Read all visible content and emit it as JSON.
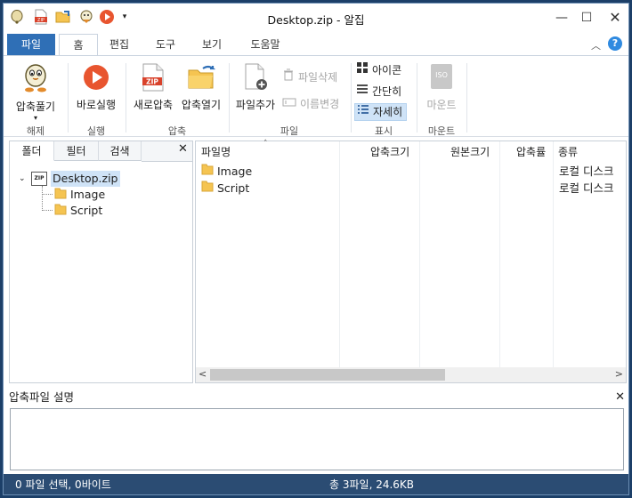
{
  "window": {
    "title": "Desktop.zip - 알집",
    "controls": [
      "minimize",
      "maximize",
      "close"
    ]
  },
  "quick_access": [
    "alzip-logo-icon",
    "zip-file-icon",
    "folder-open-icon",
    "unzip-icon",
    "run-icon",
    "dropdown-arrow"
  ],
  "ribbon_tabs": [
    "파일",
    "홈",
    "편집",
    "도구",
    "보기",
    "도움말"
  ],
  "active_tab": "홈",
  "ribbon": {
    "extract": {
      "label": "압축풀기",
      "group": "해제"
    },
    "run": {
      "label": "바로실행",
      "group": "실행"
    },
    "new_zip": {
      "label": "새로압축"
    },
    "open_zip": {
      "label": "압축열기"
    },
    "compress_group": "압축",
    "add_file": {
      "label": "파일추가"
    },
    "delete_file": {
      "label": "파일삭제"
    },
    "rename": {
      "label": "이름변경"
    },
    "file_group": "파일",
    "view_icon": "아이콘",
    "view_simple": "간단히",
    "view_detail": "자세히",
    "view_group": "표시",
    "mount": {
      "label": "마운트",
      "icon_text": "ISO",
      "group": "마운트"
    }
  },
  "tree_panel": {
    "tabs": [
      "폴더",
      "필터",
      "검색"
    ],
    "root": {
      "label": "Desktop.zip",
      "icon_text": "ZIP"
    },
    "children": [
      "Image",
      "Script"
    ]
  },
  "file_list": {
    "columns": [
      "파일명",
      "압축크기",
      "원본크기",
      "압축률",
      "종류"
    ],
    "rows": [
      {
        "name": "Image",
        "type": "로컬 디스크"
      },
      {
        "name": "Script",
        "type": "로컬 디스크"
      }
    ]
  },
  "description": {
    "title": "압축파일 설명"
  },
  "status": {
    "left": "0 파일 선택,  0바이트",
    "center": "총 3파일,  24.6KB"
  },
  "colors": {
    "accent": "#2f6fb6",
    "status_bar": "#2b4c73",
    "selection": "#cfe3f7",
    "folder": "#f5c451"
  }
}
